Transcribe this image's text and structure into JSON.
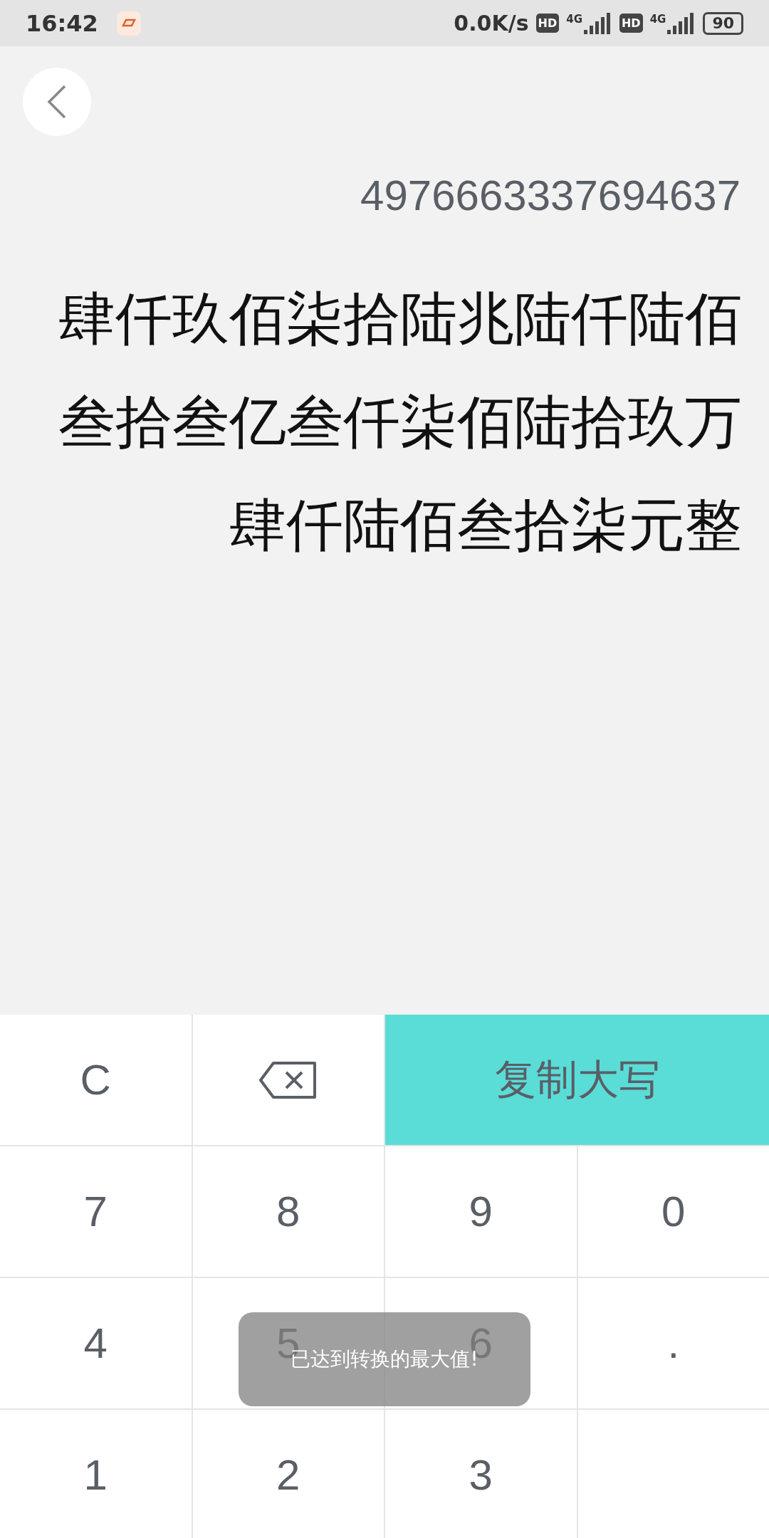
{
  "status_bar": {
    "time": "16:42",
    "speed": "0.0K/s",
    "sim1": {
      "badge": "HD",
      "network": "4G"
    },
    "sim2": {
      "badge": "HD",
      "network": "4G"
    },
    "battery": "90"
  },
  "number": "4976663337694637",
  "uppercase": "肆仟玖佰柒拾陆兆陆仟陆佰叁拾叁亿叁仟柒佰陆拾玖万肆仟陆佰叁拾柒元整",
  "keys": [
    {
      "kind": "clear",
      "label": "C"
    },
    {
      "kind": "backspace"
    },
    {
      "kind": "copy",
      "label": "复制大写"
    },
    {
      "kind": "digit",
      "label": "7"
    },
    {
      "kind": "digit",
      "label": "8"
    },
    {
      "kind": "digit",
      "label": "9"
    },
    {
      "kind": "digit",
      "label": "0"
    },
    {
      "kind": "digit",
      "label": "4"
    },
    {
      "kind": "digit",
      "label": "5"
    },
    {
      "kind": "digit",
      "label": "6"
    },
    {
      "kind": "digit",
      "label": "."
    },
    {
      "kind": "digit",
      "label": "1"
    },
    {
      "kind": "digit",
      "label": "2"
    },
    {
      "kind": "digit",
      "label": "3"
    },
    {
      "kind": "blank"
    }
  ],
  "toast": "已达到转换的最大值!"
}
